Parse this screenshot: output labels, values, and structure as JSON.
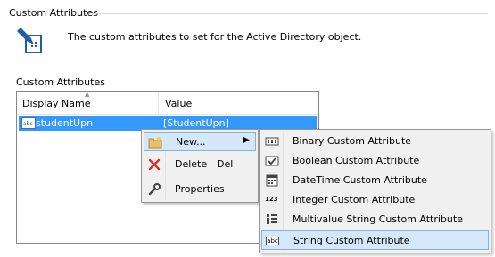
{
  "group": {
    "title": "Custom Attributes"
  },
  "header": {
    "description": "The custom attributes to set for the Active Directory object."
  },
  "section": {
    "label": "Custom Attributes"
  },
  "list": {
    "columns": [
      "Display Name",
      "Value"
    ],
    "rows": [
      {
        "name": "studentUpn",
        "value": "[StudentUpn]",
        "icon": "abc-string-icon"
      }
    ]
  },
  "context_menu": {
    "items": [
      {
        "label": "New...",
        "icon": "new-folder-icon",
        "has_submenu": true
      },
      {
        "label": "Delete",
        "shortcut": "Del",
        "icon": "delete-x-icon"
      },
      {
        "label": "Properties",
        "icon": "wrench-icon"
      }
    ]
  },
  "submenu": {
    "items": [
      {
        "label": "Binary Custom Attribute",
        "icon": "binary-icon"
      },
      {
        "label": "Boolean Custom Attribute",
        "icon": "boolean-icon"
      },
      {
        "label": "DateTime Custom Attribute",
        "icon": "calendar-icon"
      },
      {
        "label": "Integer Custom Attribute",
        "icon": "integer-icon",
        "icon_text": "123"
      },
      {
        "label": "Multivalue String Custom Attribute",
        "icon": "multivalue-icon"
      },
      {
        "label": "String Custom Attribute",
        "icon": "string-icon",
        "icon_text": "abc",
        "highlighted": true
      }
    ]
  },
  "colors": {
    "selection": "#3399ff",
    "menu_bg": "#f0f0f0",
    "menu_highlight": "#d5e7f8",
    "accent_red": "#d32f2f"
  }
}
